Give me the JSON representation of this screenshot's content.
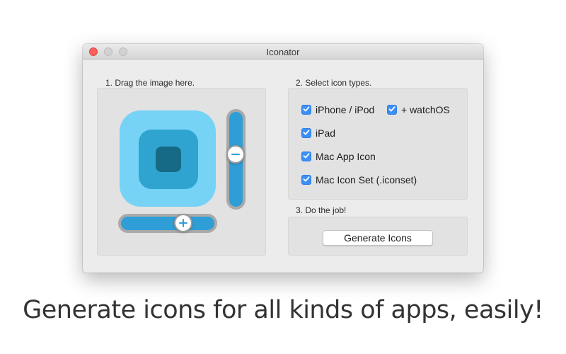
{
  "window": {
    "title": "Iconator",
    "controls": [
      "close",
      "minimize",
      "zoom"
    ]
  },
  "drop_area": {
    "label": "1. Drag the image here.",
    "vertical_slider": {
      "icon": "minus-icon",
      "value": 0.44
    },
    "horizontal_slider": {
      "icon": "plus-icon",
      "value": 0.69
    }
  },
  "icon_types": {
    "label": "2. Select icon types.",
    "options": [
      {
        "label": "iPhone / iPod",
        "checked": true
      },
      {
        "label": "+ watchOS",
        "checked": true
      },
      {
        "label": "iPad",
        "checked": true
      },
      {
        "label": "Mac App Icon",
        "checked": true
      },
      {
        "label": "Mac Icon Set (.iconset)",
        "checked": true
      }
    ]
  },
  "job": {
    "label": "3. Do the job!",
    "button_label": "Generate Icons"
  },
  "tagline": "Generate icons for all kinds of apps, easily!",
  "colors": {
    "accent": "#3b8ff6",
    "slider": "#2f9ed6",
    "close": "#fc605c",
    "icon_light": "#76d3f6",
    "icon_mid": "#2fa4d0",
    "icon_dark": "#176a86"
  }
}
